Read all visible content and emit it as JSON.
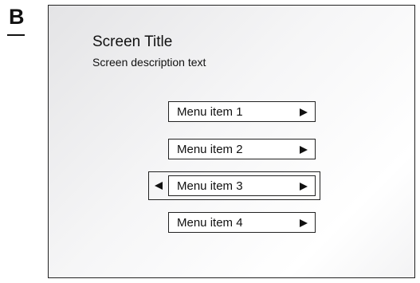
{
  "panel": {
    "letter": "B"
  },
  "screen": {
    "title": "Screen Title",
    "description": "Screen description text"
  },
  "menu": {
    "items": [
      {
        "label": "Menu item 1",
        "icon": "arrow-right-icon"
      },
      {
        "label": "Menu item 2",
        "icon": "arrow-right-icon"
      },
      {
        "label": "Menu item 3",
        "icon": "arrow-right-icon",
        "selected": true,
        "left_icon": "arrow-left-icon"
      },
      {
        "label": "Menu item 4",
        "icon": "arrow-right-icon"
      }
    ]
  }
}
